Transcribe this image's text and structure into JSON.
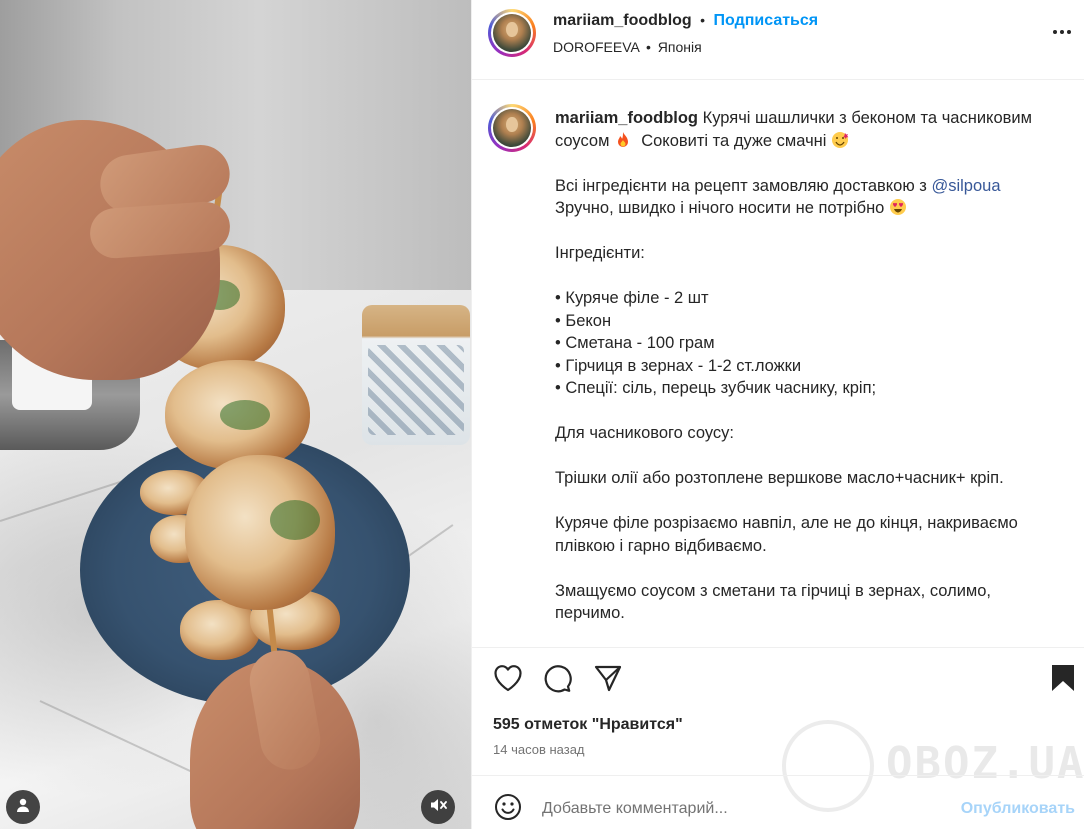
{
  "post": {
    "username": "mariiam_foodblog",
    "dot": "•",
    "follow_label": "Подписаться",
    "audio": "DOROFEEVA",
    "location": "Японія",
    "more_icon": "more-horizontal-icon"
  },
  "caption": {
    "username": "mariiam_foodblog",
    "line1": "Курячі шашлички з беконом та часниковим соусом",
    "line1b": "Соковиті та дуже смачні",
    "p2a": "Всі інгредієнти на рецепт замовляю доставкою з",
    "mention": "@silpoua",
    "p2b": "Зручно, швидко і нічого носити не потрібно",
    "ingredients_title": "Інгредієнти:",
    "ingredients": [
      "• Куряче філе - 2 шт",
      "• Бекон",
      "• Сметана - 100 грам",
      "• Гірчиця в зернах - 1-2 ст.ложки",
      "• Спеції: сіль, перець зубчик часнику, кріп;"
    ],
    "sauce_title": "Для часникового соусу:",
    "sauce": "Трішки олії або розтоплене вершкове масло+часник+ кріп.",
    "step1": "Куряче філе розрізаємо навпіл, але не до кінця, накриваємо плівкою і гарно відбиваємо.",
    "step2": "Змащуємо соусом з сметани та гірчиці в зернах, солимо, перчимо."
  },
  "actions": {
    "likes": "595 отметок \"Нравится\"",
    "time": "14 часов назад"
  },
  "comment": {
    "placeholder": "Добавьте комментарий...",
    "publish": "Опубликовать"
  },
  "watermark": "OBOZ.UA",
  "colors": {
    "link_blue": "#0095f6",
    "mention_blue": "#385898",
    "publish_disabled": "#a7d4f9",
    "text": "#262626",
    "muted": "#737373"
  }
}
